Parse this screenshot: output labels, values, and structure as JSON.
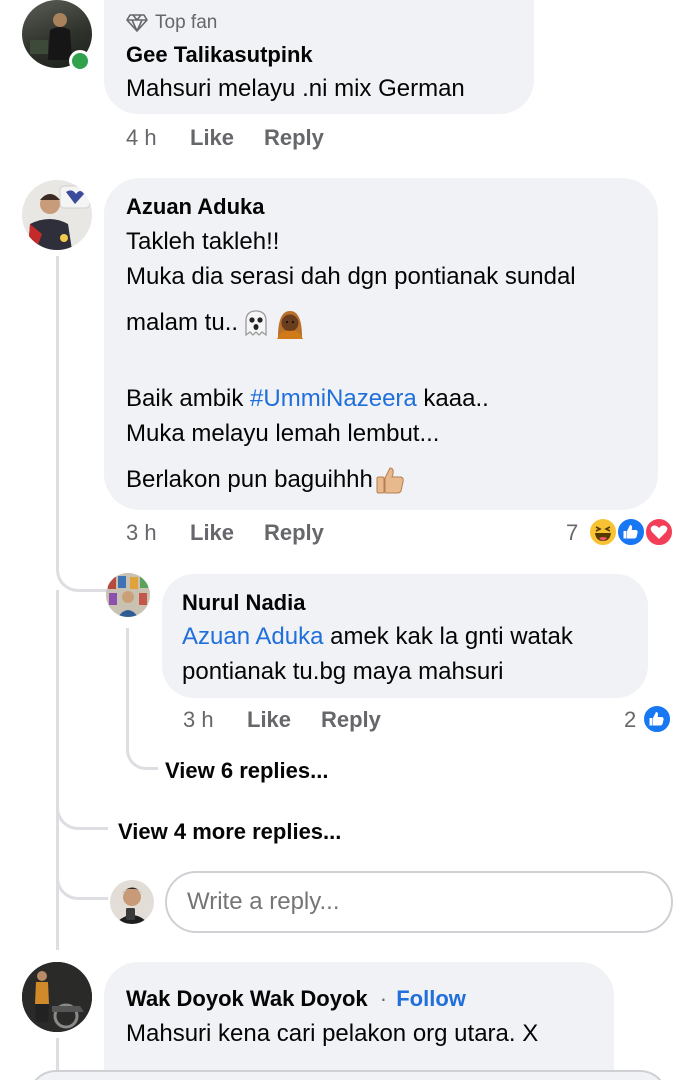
{
  "comments": [
    {
      "badge": "Top fan",
      "author": "Gee Talikasutpink",
      "lines": [
        "Mahsuri melayu  .ni mix German"
      ],
      "time": "4 h",
      "like": "Like",
      "reply": "Reply"
    },
    {
      "author": "Azuan Aduka",
      "line1": "Takleh takleh!!",
      "line2": "Muka dia serasi dah dgn pontianak sundal",
      "line3": "malam tu..",
      "line4_pre": "Baik ambik ",
      "hashtag": "#UmmiNazeera",
      "line4_post": " kaaa..",
      "line5": "Muka melayu lemah lembut...",
      "line6": "Berlakon pun baguihhh",
      "time": "3 h",
      "like": "Like",
      "reply": "Reply",
      "reaction_count": "7",
      "reactions": [
        "haha-icon",
        "like-icon",
        "love-icon"
      ]
    },
    {
      "author": "Nurul Nadia",
      "mention": "Azuan Aduka",
      "line1_rest": " amek kak la gnti watak",
      "line2": "pontianak tu.bg maya mahsuri",
      "time": "3 h",
      "like": "Like",
      "reply": "Reply",
      "reaction_count": "2",
      "reactions": [
        "like-icon"
      ]
    },
    {
      "author": "Wak Doyok Wak Doyok",
      "follow_sep": "·",
      "follow": "Follow",
      "line1": "Mahsuri kena cari pelakon org utara. X"
    }
  ],
  "view_nested_replies": "View 6 replies...",
  "view_more_replies": "View 4 more replies...",
  "reply_input": {
    "placeholder": "Write a reply..."
  },
  "colors": {
    "bubble": "#f0f2f5",
    "link": "#216fdb",
    "meta": "#65676b",
    "online": "#31a24c"
  }
}
